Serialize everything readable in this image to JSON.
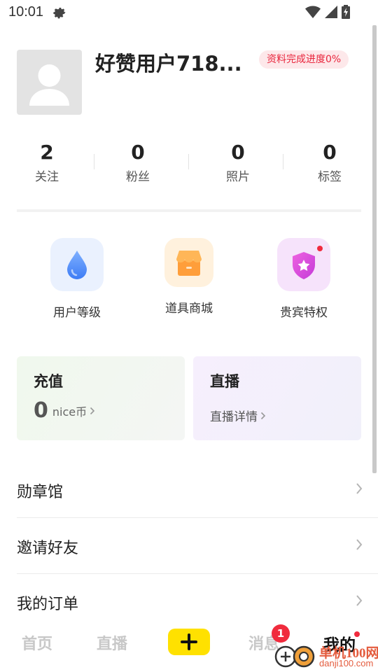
{
  "status_bar": {
    "time": "10:01",
    "icons": [
      "gear-icon",
      "wifi-icon",
      "signal-icon",
      "battery-charging-icon"
    ]
  },
  "profile": {
    "username": "好赞用户718...",
    "progress_badge": "资料完成进度0%"
  },
  "stats": [
    {
      "value": "2",
      "label": "关注"
    },
    {
      "value": "0",
      "label": "粉丝"
    },
    {
      "value": "0",
      "label": "照片"
    },
    {
      "value": "0",
      "label": "标签"
    }
  ],
  "features": [
    {
      "label": "用户等级",
      "icon": "water-drop-icon",
      "color": "#4f8bff"
    },
    {
      "label": "道具商城",
      "icon": "shop-icon",
      "color": "#ffa53d"
    },
    {
      "label": "贵宾特权",
      "icon": "vip-shield-icon",
      "color": "#e14fd6"
    }
  ],
  "cards": {
    "recharge": {
      "title": "充值",
      "value": "0",
      "unit": "nice币"
    },
    "live": {
      "title": "直播",
      "detail": "直播详情"
    }
  },
  "menu": [
    {
      "label": "勋章馆"
    },
    {
      "label": "邀请好友"
    },
    {
      "label": "我的订单"
    }
  ],
  "tabbar": {
    "home": "首页",
    "live": "直播",
    "messages": "消息",
    "messages_badge": "1",
    "mine": "我的"
  },
  "watermark": {
    "line1": "单机100网",
    "line2": "danji100.com"
  },
  "colors": {
    "accent_yellow": "#ffe100",
    "badge_red": "#f02b3d",
    "progress_text": "#e9253c"
  }
}
